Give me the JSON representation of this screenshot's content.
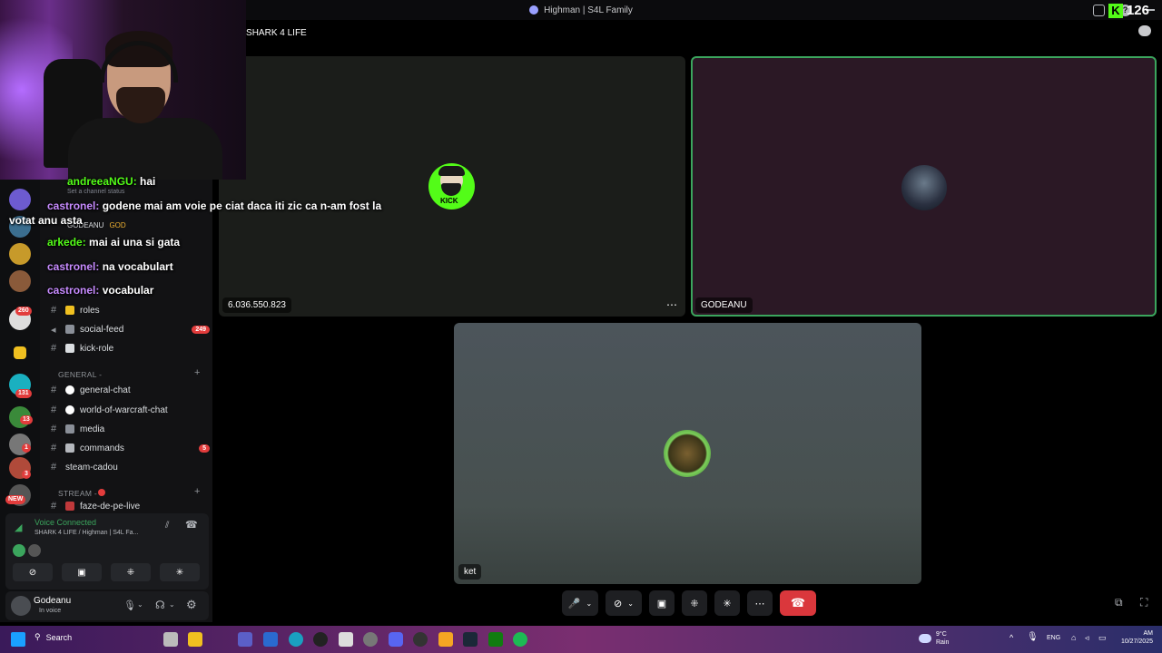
{
  "window": {
    "title": "Highman | S4L Family"
  },
  "topbar": {
    "kick_count": "126"
  },
  "call": {
    "header": "SHARK 4 LIFE",
    "tiles": [
      {
        "name": "6.036.550.823",
        "avatar_label": "KICK"
      },
      {
        "name": "GODEANU"
      },
      {
        "name": "ket"
      }
    ]
  },
  "chat_overlay": [
    {
      "user": "andreeaNGU:",
      "text": "hai"
    },
    {
      "user": "castronel:",
      "text": "godene mai am voie pe ciat daca iti zic ca n-am fost la"
    },
    {
      "user": "",
      "text": "votat anu asta"
    },
    {
      "user": "arkede:",
      "text": "mai ai una si gata"
    },
    {
      "user": "castronel:",
      "text": "na vocabulart"
    },
    {
      "user": "castronel:",
      "text": "vocabular"
    }
  ],
  "sidebar": {
    "status_hint": "Set a channel status",
    "member_name": "GODEANU",
    "member_tag": "GOD",
    "channels_top": [
      {
        "name": "roles"
      },
      {
        "name": "social-feed",
        "count": "249"
      },
      {
        "name": "kick-role"
      }
    ],
    "category_general": "GENERAL -",
    "channels_general": [
      {
        "name": "general-chat"
      },
      {
        "name": "world-of-warcraft-chat"
      },
      {
        "name": "media"
      },
      {
        "name": "commands",
        "count": "5"
      },
      {
        "name": "steam-cadou"
      }
    ],
    "category_stream": "STREAM -",
    "channels_stream": [
      {
        "name": "faze-de-pe-live"
      }
    ]
  },
  "rail_badges": [
    "260",
    "131",
    "13",
    "1",
    "3",
    "NEW"
  ],
  "voice": {
    "status": "Voice Connected",
    "location": "SHARK 4 LIFE / Highman | S4L Fa..."
  },
  "user": {
    "name": "Godeanu",
    "status": "In voice"
  },
  "taskbar": {
    "search": "Search",
    "weather_temp": "9°C",
    "weather_desc": "Rain",
    "lang": "ENG",
    "time": "AM",
    "date": "10/27/2025"
  },
  "colors": {
    "accent_green": "#3ba55d",
    "kick_green": "#53fc18",
    "hangup_red": "#da373c"
  }
}
